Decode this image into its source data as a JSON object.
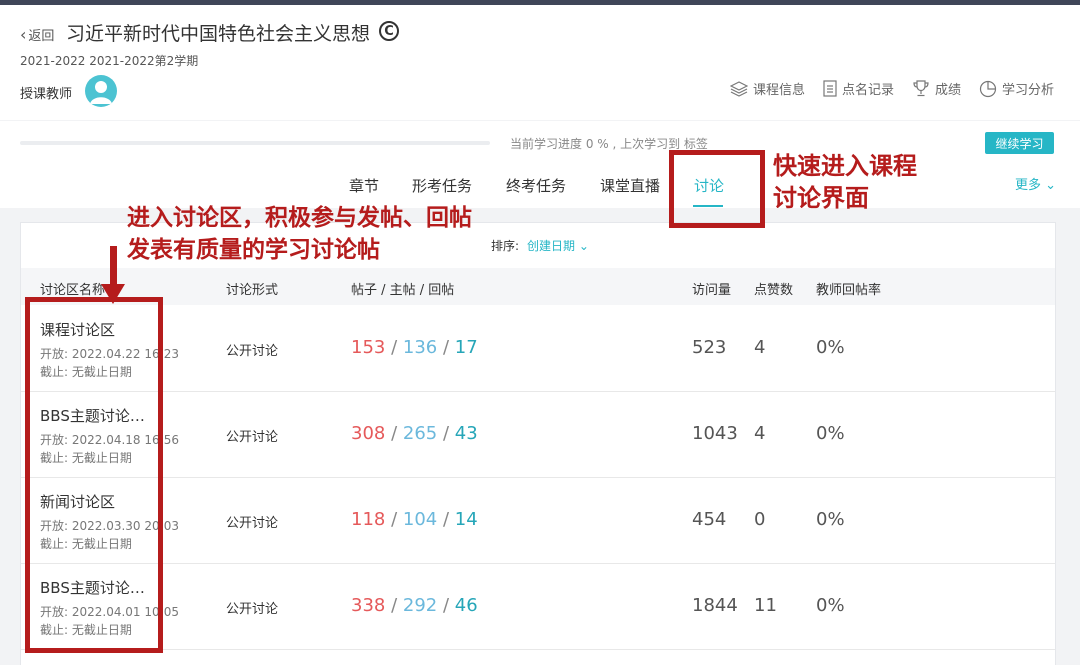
{
  "header": {
    "back_label": "返回",
    "course_title": "习近平新时代中国特色社会主义思想",
    "copyright_symbol": "C",
    "term": "2021-2022 2021-2022第2学期",
    "teacher_label": "授课教师",
    "links": [
      {
        "label": "课程信息",
        "icon": "layers-icon"
      },
      {
        "label": "点名记录",
        "icon": "document-icon"
      },
      {
        "label": "成绩",
        "icon": "trophy-icon"
      },
      {
        "label": "学习分析",
        "icon": "pie-chart-icon"
      }
    ]
  },
  "progress": {
    "fraction": 0,
    "text": "当前学习进度 0 % , 上次学习到 标签",
    "continue_label": "继续学习"
  },
  "tabs": [
    {
      "label": "章节",
      "active": false
    },
    {
      "label": "形考任务",
      "active": false
    },
    {
      "label": "终考任务",
      "active": false
    },
    {
      "label": "课堂直播",
      "active": false
    },
    {
      "label": "讨论",
      "active": true
    }
  ],
  "more_label": "更多 ⌄",
  "sort": {
    "label": "排序:",
    "value": "创建日期 ⌄"
  },
  "table": {
    "headers": [
      "讨论区名称",
      "讨论形式",
      "帖子 / 主帖 / 回帖",
      "访问量",
      "点赞数",
      "教师回帖率"
    ],
    "rows": [
      {
        "name": "课程讨论区",
        "open": "开放:  2022.04.22 16:23",
        "close": "截止:  无截止日期",
        "type": "公开讨论",
        "posts": "153",
        "main": "136",
        "replies": "17",
        "visits": "523",
        "likes": "4",
        "rate": "0%"
      },
      {
        "name": "BBS主题讨论…",
        "open": "开放:  2022.04.18 16:56",
        "close": "截止:  无截止日期",
        "type": "公开讨论",
        "posts": "308",
        "main": "265",
        "replies": "43",
        "visits": "1043",
        "likes": "4",
        "rate": "0%"
      },
      {
        "name": "新闻讨论区",
        "open": "开放:  2022.03.30 20:03",
        "close": "截止:  无截止日期",
        "type": "公开讨论",
        "posts": "118",
        "main": "104",
        "replies": "14",
        "visits": "454",
        "likes": "0",
        "rate": "0%"
      },
      {
        "name": "BBS主题讨论…",
        "open": "开放:  2022.04.01 10:05",
        "close": "截止:  无截止日期",
        "type": "公开讨论",
        "posts": "338",
        "main": "292",
        "replies": "46",
        "visits": "1844",
        "likes": "11",
        "rate": "0%"
      }
    ]
  },
  "annotations": {
    "tab_note": "快速进入课程\n讨论界面",
    "table_note": "进入讨论区，积极参与发帖、回帖\n发表有质量的学习讨论帖"
  },
  "colors": {
    "accent": "#26b6c6",
    "annotation": "#b51c1c",
    "posts": "#e5595a",
    "main_posts": "#6bb8dc",
    "replies": "#26a6b8"
  }
}
